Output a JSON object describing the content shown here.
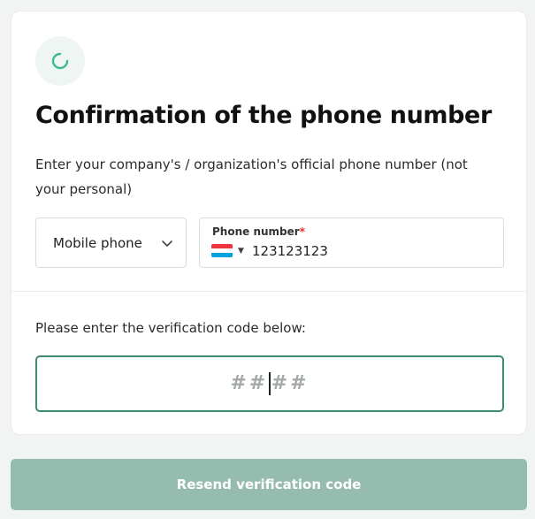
{
  "card": {
    "loader_icon": "loading-spinner-icon",
    "title": "Confirmation of the phone number",
    "description": "Enter your company's / organization's official phone number (not your personal)"
  },
  "phone_type": {
    "selected": "Mobile phone",
    "chevron_icon": "chevron-down-icon"
  },
  "phone": {
    "label": "Phone number",
    "required_mark": "*",
    "country_flag": "luxembourg-flag-icon",
    "value": "123123123"
  },
  "verification": {
    "label": "Please enter the verification code below:",
    "placeholder_left": "##",
    "placeholder_right": "##"
  },
  "resend_button_label": "Resend verification code",
  "colors": {
    "accent": "#3e8a6b",
    "button_disabled": "#95bcae",
    "spinner": "#3dbb8a",
    "flag_red": "#ef3340",
    "flag_white": "#ffffff",
    "flag_blue": "#00a3e0"
  }
}
